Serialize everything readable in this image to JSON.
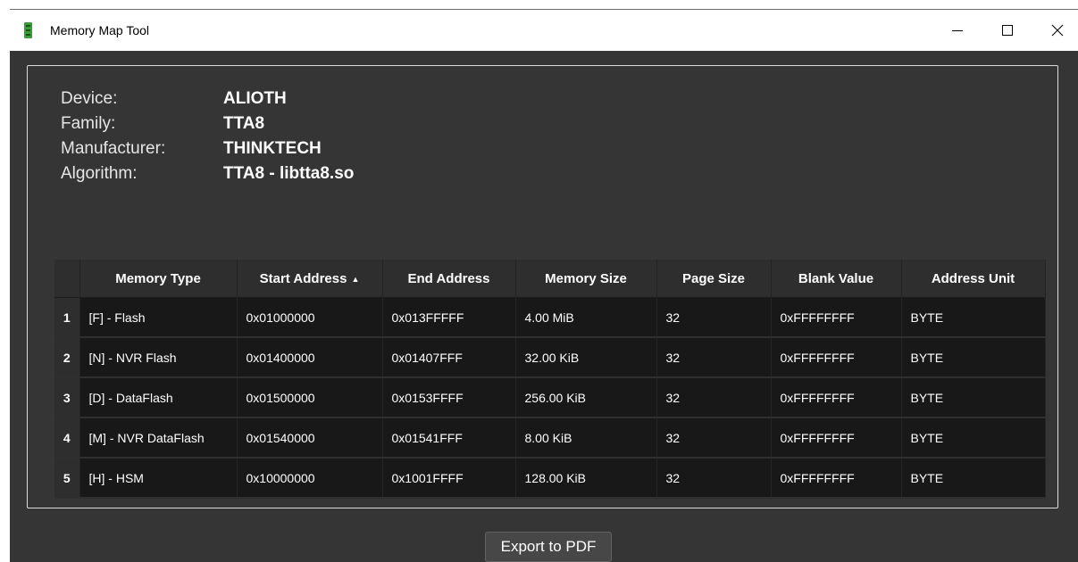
{
  "window": {
    "title": "Memory Map Tool"
  },
  "device_info": [
    {
      "label": "Device:",
      "value": "ALIOTH"
    },
    {
      "label": "Family:",
      "value": "TTA8"
    },
    {
      "label": "Manufacturer:",
      "value": "THINKTECH"
    },
    {
      "label": "Algorithm:",
      "value": "TTA8 - libtta8.so"
    }
  ],
  "table": {
    "headers": [
      "Memory Type",
      "Start Address",
      "End Address",
      "Memory Size",
      "Page Size",
      "Blank Value",
      "Address Unit"
    ],
    "sorted_column": "Start Address",
    "sort_direction": "ascending",
    "rows": [
      {
        "num": "1",
        "cells": [
          "[F] - Flash",
          "0x01000000",
          "0x013FFFFF",
          "4.00 MiB",
          "32",
          "0xFFFFFFFF",
          "BYTE"
        ]
      },
      {
        "num": "2",
        "cells": [
          "[N] - NVR Flash",
          "0x01400000",
          "0x01407FFF",
          "32.00 KiB",
          "32",
          "0xFFFFFFFF",
          "BYTE"
        ]
      },
      {
        "num": "3",
        "cells": [
          "[D] - DataFlash",
          "0x01500000",
          "0x0153FFFF",
          "256.00 KiB",
          "32",
          "0xFFFFFFFF",
          "BYTE"
        ]
      },
      {
        "num": "4",
        "cells": [
          "[M] - NVR DataFlash",
          "0x01540000",
          "0x01541FFF",
          "8.00 KiB",
          "32",
          "0xFFFFFFFF",
          "BYTE"
        ]
      },
      {
        "num": "5",
        "cells": [
          "[H] - HSM",
          "0x10000000",
          "0x1001FFFF",
          "128.00 KiB",
          "32",
          "0xFFFFFFFF",
          "BYTE"
        ]
      }
    ]
  },
  "export_button": {
    "label": "Export to PDF"
  },
  "icons": {
    "app": "memory-chip-icon",
    "minimize": "minimize-icon",
    "maximize": "maximize-icon",
    "close": "close-icon",
    "sort": "sort-ascending-icon"
  },
  "colors": {
    "background": "#353535",
    "table_background": "#181818",
    "header_background": "#2e2e2e",
    "text": "#ffffff",
    "app_icon": "#3a9d3a"
  }
}
